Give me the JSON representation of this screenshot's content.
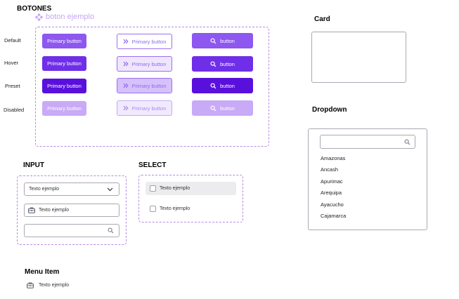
{
  "buttons_section": {
    "title": "BOTONES",
    "component_label": "boton ejemplo",
    "states": [
      "Default",
      "Hover",
      "Preset",
      "Disabled"
    ],
    "primary_label": "Primary button",
    "outline_label": "Primary button",
    "icon_label": "button"
  },
  "colors": {
    "default": "#8d57f0",
    "hover": "#6f2ee8",
    "preset": "#5a10dc",
    "disabled": "#c9aaf6",
    "dashed_border": "#b78ae6"
  },
  "card": {
    "title": "Card"
  },
  "dropdown": {
    "title": "Dropdown",
    "options": [
      "Amazonas",
      "Ancash",
      "Apurimac",
      "Arequipa",
      "Ayacucho",
      "Cajamarca"
    ]
  },
  "input": {
    "title": "INPUT",
    "select_value": "Texto ejemplo",
    "icon_field_value": "Texto ejemplo"
  },
  "select": {
    "title": "SELECT",
    "options": [
      "Texto ejemplo",
      "Texto ejemplo"
    ]
  },
  "menu_item": {
    "title": "Menu Item",
    "label": "Texto ejemplo"
  },
  "icons": {
    "component": "component-diamond-icon",
    "chevrons": "double-chevron-right-icon",
    "search": "search-icon",
    "briefcase": "briefcase-icon",
    "chevron_down": "chevron-down-icon"
  }
}
